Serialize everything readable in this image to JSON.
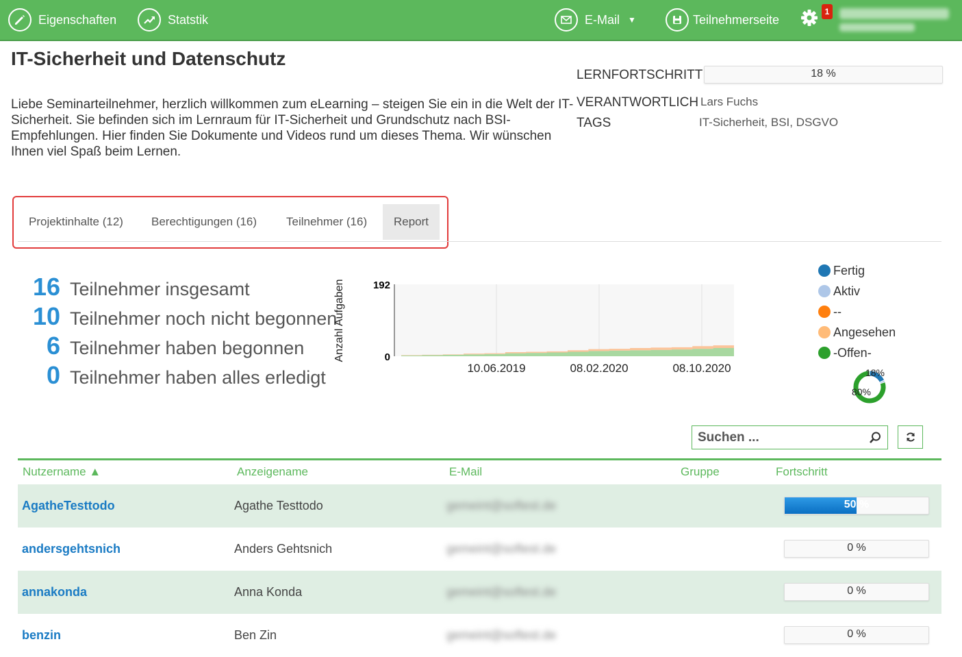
{
  "topbar": {
    "properties_label": "Eigenschaften",
    "statistics_label": "Statstik",
    "email_label": "E-Mail",
    "participant_page_label": "Teilnehmerseite",
    "notification_count": "1",
    "accent_color": "#5cb85c"
  },
  "course": {
    "title": "IT-Sicherheit und Datenschutz",
    "description": "Liebe Seminarteilnehmer, herzlich willkommen zum eLearning – steigen Sie ein in die Welt der IT-Sicherheit. Sie befinden sich im Lernraum für IT-Sicherheit und Grundschutz nach BSI-Empfehlungen. Hier finden Sie Dokumente und Videos rund um dieses Thema. Wir wünschen Ihnen viel Spaß beim Lernen.",
    "progress_label": "LERNFORTSCHRITT",
    "progress_value": 18,
    "progress_text": "18 %",
    "responsible_label": "VERANTWORTLICH",
    "responsible_value": "Lars Fuchs",
    "tags_label": "TAGS",
    "tags_value": "IT-Sicherheit, BSI, DSGVO"
  },
  "tabs": [
    {
      "label": "Projektinhalte (12)",
      "active": false
    },
    {
      "label": "Berechtigungen (16)",
      "active": false
    },
    {
      "label": "Teilnehmer (16)",
      "active": false
    },
    {
      "label": "Report",
      "active": true
    }
  ],
  "stats": [
    {
      "num": "16",
      "label": "Teilnehmer insgesamt"
    },
    {
      "num": "10",
      "label": "Teilnehmer noch nicht begonnen"
    },
    {
      "num": "6",
      "label": "Teilnehmer haben begonnen"
    },
    {
      "num": "0",
      "label": "Teilnehmer haben alles erledigt"
    }
  ],
  "chart_data": {
    "type": "area",
    "ylabel": "Anzahl Aufgaben",
    "ylim": [
      0,
      192
    ],
    "y_ticks": [
      "192",
      "0"
    ],
    "x_ticks": [
      "10.06.2019",
      "08.02.2020",
      "08.10.2020"
    ],
    "series": [
      {
        "name": "-Offen-",
        "color": "#a8d8a0",
        "values": [
          2,
          3,
          4,
          5,
          6,
          8,
          9,
          10,
          12,
          14,
          15,
          16,
          17,
          18,
          20,
          22,
          24
        ]
      },
      {
        "name": "Angesehen",
        "color": "#fcc49a",
        "values": [
          1,
          1,
          1,
          2,
          2,
          3,
          3,
          3,
          4,
          5,
          5,
          6,
          6,
          6,
          7,
          7,
          8
        ]
      }
    ],
    "legend": [
      {
        "name": "Fertig",
        "color": "#1f77b4"
      },
      {
        "name": "Aktiv",
        "color": "#aec7e8"
      },
      {
        "name": "--",
        "color": "#ff7f0e"
      },
      {
        "name": "Angesehen",
        "color": "#ffbb78"
      },
      {
        "name": "-Offen-",
        "color": "#2ca02c"
      }
    ],
    "donut": [
      {
        "name": "Fertig",
        "value": 18,
        "label": "18%",
        "color": "#1f77b4"
      },
      {
        "name": "Aktiv",
        "value": 2,
        "label": "",
        "color": "#aec7e8"
      },
      {
        "name": "-Offen-",
        "value": 80,
        "label": "80%",
        "color": "#2ca02c"
      }
    ]
  },
  "search": {
    "placeholder": "Suchen ..."
  },
  "table": {
    "headers": {
      "username": "Nutzername ▲",
      "display": "Anzeigename",
      "email": "E-Mail",
      "group": "Gruppe",
      "progress": "Fortschritt"
    },
    "rows": [
      {
        "username": "AgatheTesttodo",
        "display": "Agathe Testtodo",
        "email": "gemeint@softest.de",
        "progress": 50,
        "progress_text": "50 %"
      },
      {
        "username": "andersgehtsnich",
        "display": "Anders Gehtsnich",
        "email": "gemeint@softest.de",
        "progress": 0,
        "progress_text": "0 %"
      },
      {
        "username": "annakonda",
        "display": "Anna Konda",
        "email": "gemeint@softest.de",
        "progress": 0,
        "progress_text": "0 %"
      },
      {
        "username": "benzin",
        "display": "Ben Zin",
        "email": "gemeint@softest.de",
        "progress": 0,
        "progress_text": "0 %"
      }
    ]
  }
}
